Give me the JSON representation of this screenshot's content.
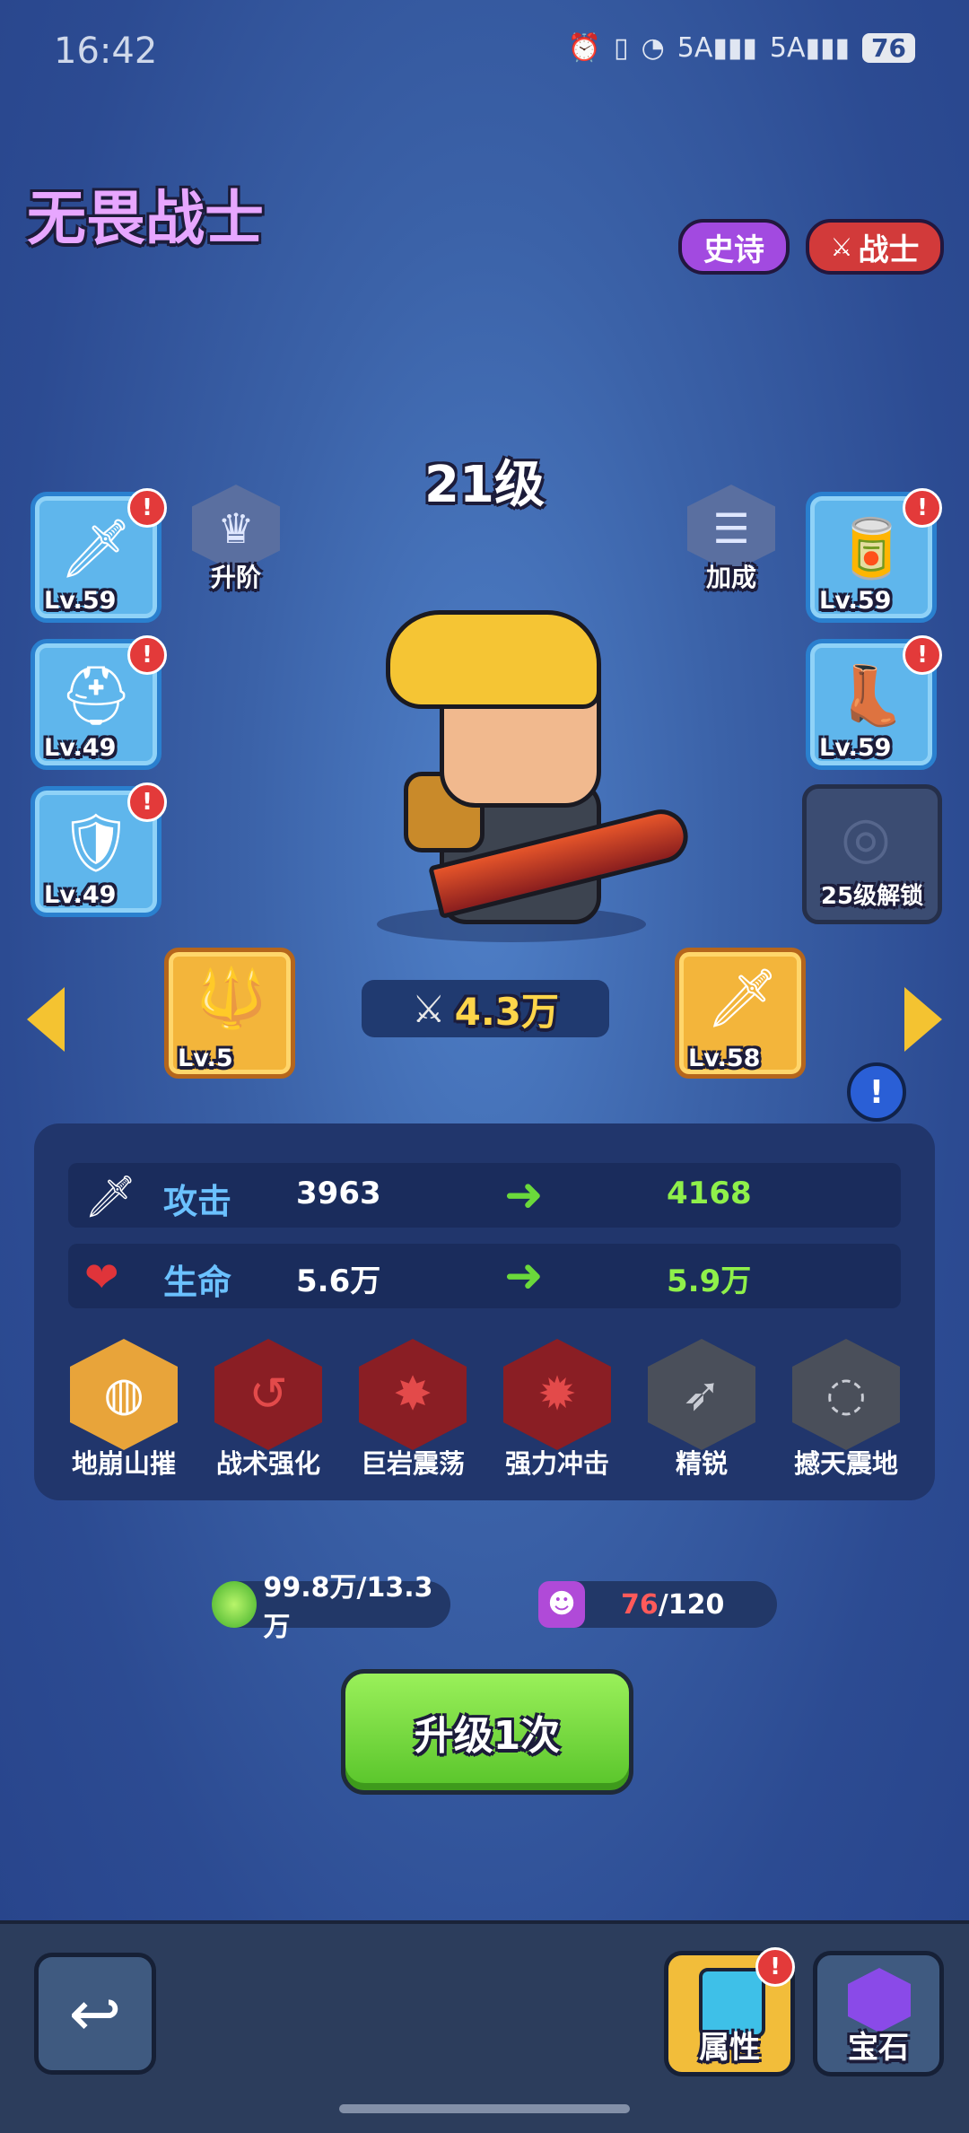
{
  "status_bar": {
    "time": "16:42",
    "signal_1": "5A",
    "signal_2": "5A",
    "battery": "76"
  },
  "hero": {
    "name": "无畏战士",
    "rarity": "史诗",
    "class": "战士",
    "level": "21级",
    "power": "4.3万"
  },
  "actions": {
    "advance_label": "升阶",
    "bonus_label": "加成"
  },
  "equipment_left": [
    {
      "name": "sword",
      "level": "Lv.59",
      "alert": "!"
    },
    {
      "name": "helmet",
      "level": "Lv.49",
      "alert": "!"
    },
    {
      "name": "armor",
      "level": "Lv.49",
      "alert": "!"
    }
  ],
  "equipment_right": [
    {
      "name": "bracer",
      "level": "Lv.59",
      "alert": "!"
    },
    {
      "name": "boots",
      "level": "Lv.59",
      "alert": "!"
    }
  ],
  "locked_slot": {
    "label": "25级解锁"
  },
  "weapons": {
    "left_level": "Lv.5",
    "right_level": "Lv.58"
  },
  "info_icon": "!",
  "stats": [
    {
      "name": "攻击",
      "current": "3963",
      "next": "4168"
    },
    {
      "name": "生命",
      "current": "5.6万",
      "next": "5.9万"
    }
  ],
  "skills": [
    {
      "name": "地崩山摧",
      "color": "#e8a43a"
    },
    {
      "name": "战术强化",
      "color": "#8a1e24"
    },
    {
      "name": "巨岩震荡",
      "color": "#8a1e24"
    },
    {
      "name": "强力冲击",
      "color": "#8a1e24"
    },
    {
      "name": "精锐",
      "color": "#4a4f5a"
    },
    {
      "name": "撼天震地",
      "color": "#4a4f5a"
    }
  ],
  "resources": {
    "exp": "99.8万/13.3万",
    "shards_current": "76",
    "shards_total": "/120"
  },
  "upgrade_button": {
    "label": "升级1次"
  },
  "bottom": {
    "attributes_label": "属性",
    "attributes_alert": "!",
    "gems_label": "宝石"
  }
}
